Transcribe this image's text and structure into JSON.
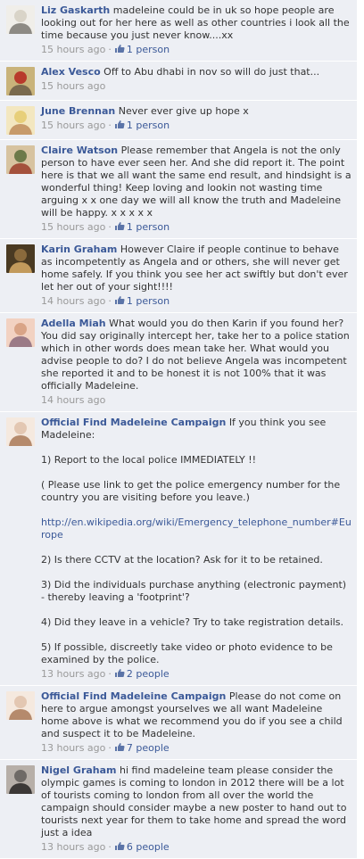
{
  "comments": [
    {
      "author": "Liz Gaskarth",
      "text": "madeleine could be in uk so hope people are looking out for her here as well as other countries i look all the time because you just never know....xx",
      "time": "15 hours ago",
      "likes": "1 person",
      "avatar": {
        "colors": [
          "#d9d4c8",
          "#8d8a84",
          "#f0eee9"
        ],
        "icon": "profile-photo-icon"
      }
    },
    {
      "author": "Alex Vesco",
      "text": "Off to Abu dhabi in nov so will do just that...",
      "time": "15 hours ago",
      "likes": "",
      "avatar": {
        "colors": [
          "#b83a2c",
          "#7a6a4e",
          "#c9b37a"
        ],
        "icon": "profile-photo-icon"
      }
    },
    {
      "author": "June Brennan",
      "text": "Never ever give up hope x",
      "time": "15 hours ago",
      "likes": "1 person",
      "avatar": {
        "colors": [
          "#e7cf7a",
          "#c79a6a",
          "#f3e7c0"
        ],
        "icon": "profile-photo-icon"
      }
    },
    {
      "author": "Claire Watson",
      "text": "Please remember that Angela is not the only person to have ever seen her. And she did report it. The point here is that we all want the same end result, and hindsight is a wonderful thing! Keep loving and lookin not wasting time arguing x x one day we will all know the truth and Madeleine will be happy. x x x x x",
      "time": "15 hours ago",
      "likes": "1 person",
      "avatar": {
        "colors": [
          "#6d7a4a",
          "#a4513c",
          "#d7c3a0"
        ],
        "icon": "profile-photo-icon"
      }
    },
    {
      "author": "Karin Graham",
      "text": "However Claire if people continue to behave as incompetently as Angela and or others, she will never get home safely. If you think you see her act swiftly but don't ever let her out of your sight!!!!",
      "time": "14 hours ago",
      "likes": "1 person",
      "avatar": {
        "colors": [
          "#8a6a3c",
          "#c29a5c",
          "#4a3a22"
        ],
        "icon": "profile-photo-icon"
      }
    },
    {
      "author": "Adella Miah",
      "text": "What would you do then Karin if you found her? You did say originally intercept her, take her to a police station which in other words does mean take her. What would you advise people to do? I do not believe Angela was incompetent she reported it and to be honest it is not 100% that it was officially Madeleine.",
      "time": "14 hours ago",
      "likes": "",
      "avatar": {
        "colors": [
          "#d9a487",
          "#9b7a86",
          "#f2d2c2"
        ],
        "icon": "profile-photo-icon"
      }
    },
    {
      "author": "Official Find Madeleine Campaign",
      "text": "If you think you see Madeleine:",
      "paragraphs": [
        "1) Report to the local police IMMEDIATELY !!",
        "( Please use link to get the police emergency number for the country you are visiting before you leave.)",
        "2) Is there CCTV at the location? Ask for it to be retained.",
        "3) Did the individuals purchase anything (electronic payment) - thereby leaving a 'footprint'?",
        "4) Did they leave in a vehicle? Try to take registration details.",
        "5) If possible, discreetly take video or photo evidence to be examined by the police."
      ],
      "link": "http://en.wikipedia.org/wiki/Emergency_telephone_number#Europe",
      "time": "13 hours ago",
      "likes": "2 people",
      "avatar": {
        "colors": [
          "#e3c7b2",
          "#b58a6c",
          "#f5e9df"
        ],
        "icon": "profile-photo-icon"
      }
    },
    {
      "author": "Official Find Madeleine Campaign",
      "text": "Please do not come on here to argue amongst yourselves we all want Madeleine home above is what we recommend you do if you see a child and suspect it to be Madeleine.",
      "time": "13 hours ago",
      "likes": "7 people",
      "avatar": {
        "colors": [
          "#e3c7b2",
          "#b58a6c",
          "#f5e9df"
        ],
        "icon": "profile-photo-icon"
      }
    },
    {
      "author": "Nigel Graham",
      "text": "hi find madeleine team please consider the olympic games is coming to london in 2012 there will be a lot of tourists coming to london from all over the world the campaign should consider maybe a new poster to hand out to tourists next year for them to take home and spread the word just a idea",
      "time": "13 hours ago",
      "likes": "6 people",
      "avatar": {
        "colors": [
          "#6f6a66",
          "#3c3836",
          "#b7afa8"
        ],
        "icon": "profile-photo-icon"
      }
    }
  ],
  "colors": {
    "author": "#3b5998",
    "comment_bg": "#edeff4",
    "meta": "#999999"
  }
}
